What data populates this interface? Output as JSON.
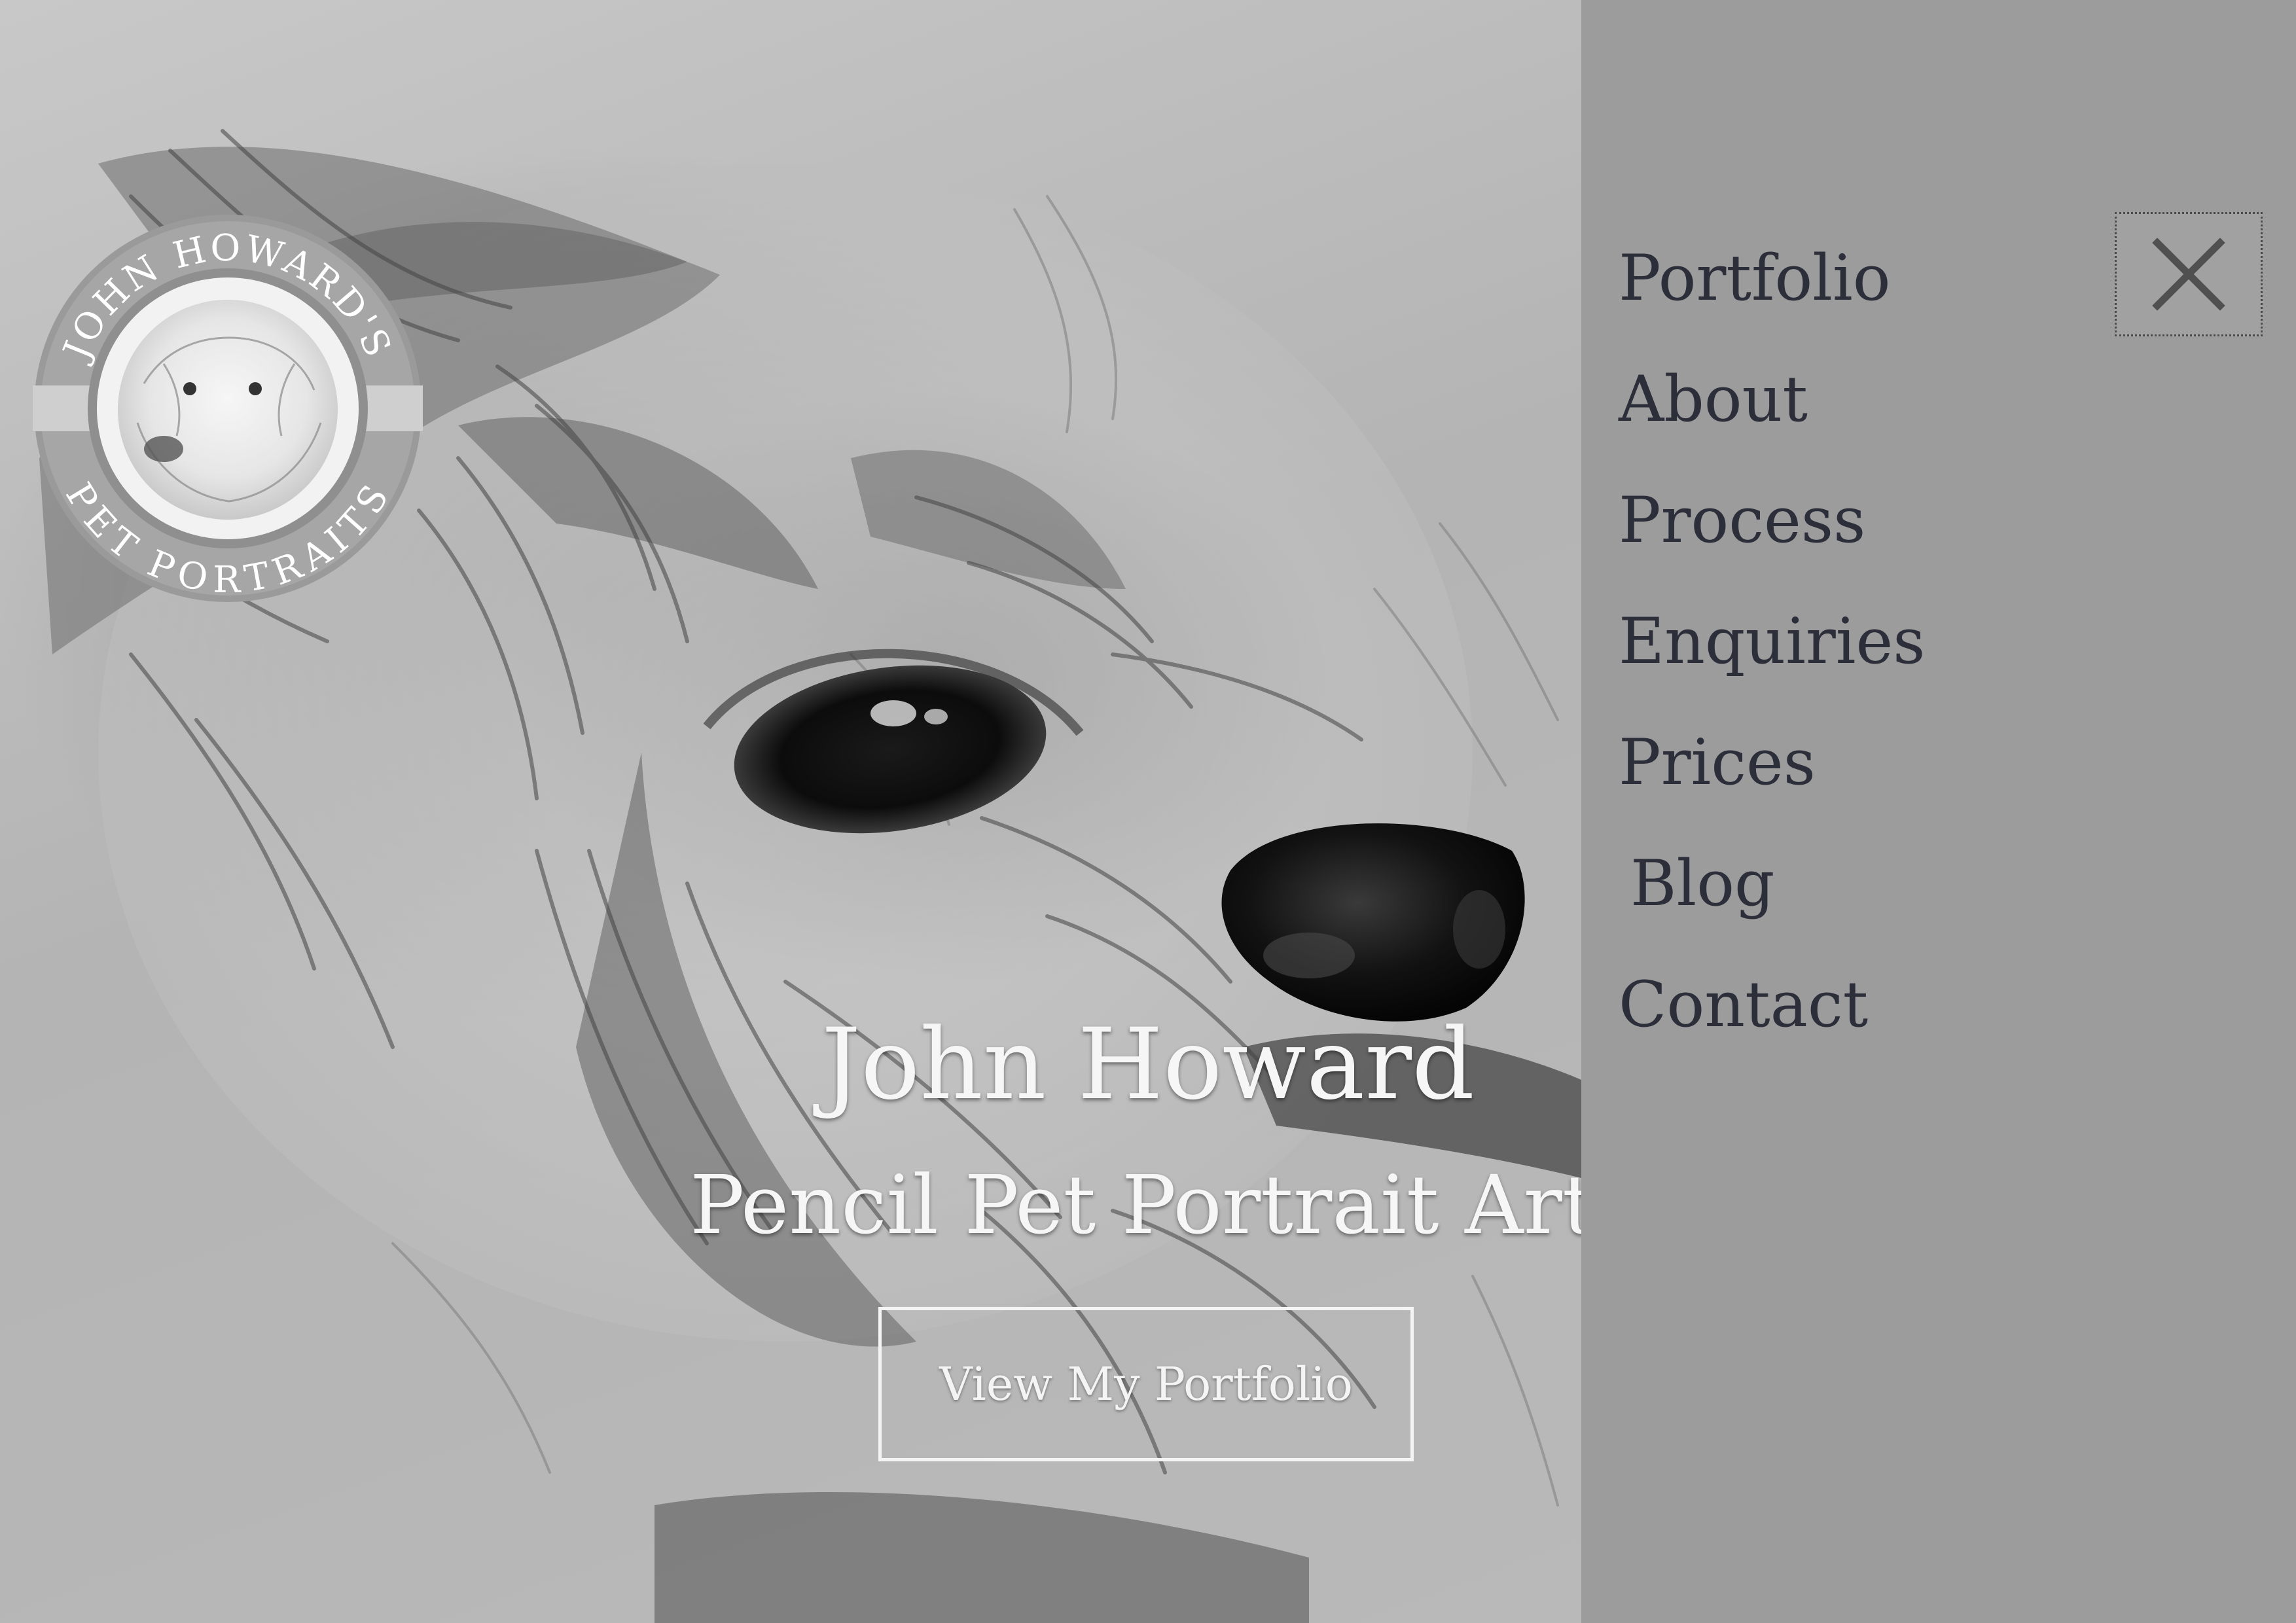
{
  "logo": {
    "text_top": "JOHN HOWARD'S",
    "text_bottom": "PET PORTRAITS"
  },
  "hero": {
    "name": "John Howard",
    "subtitle": "Pencil Pet Portrait Artist",
    "cta_label": "View My Portfolio"
  },
  "nav": {
    "items": [
      {
        "label": "Portfolio"
      },
      {
        "label": "About"
      },
      {
        "label": "Process"
      },
      {
        "label": "Enquiries"
      },
      {
        "label": "Prices"
      },
      {
        "label": "Blog"
      },
      {
        "label": "Contact"
      }
    ],
    "close_icon": "close-icon"
  },
  "colors": {
    "nav_background": "#9c9c9c",
    "nav_text": "#2c2f3a",
    "hero_text": "#f6f6f6"
  }
}
